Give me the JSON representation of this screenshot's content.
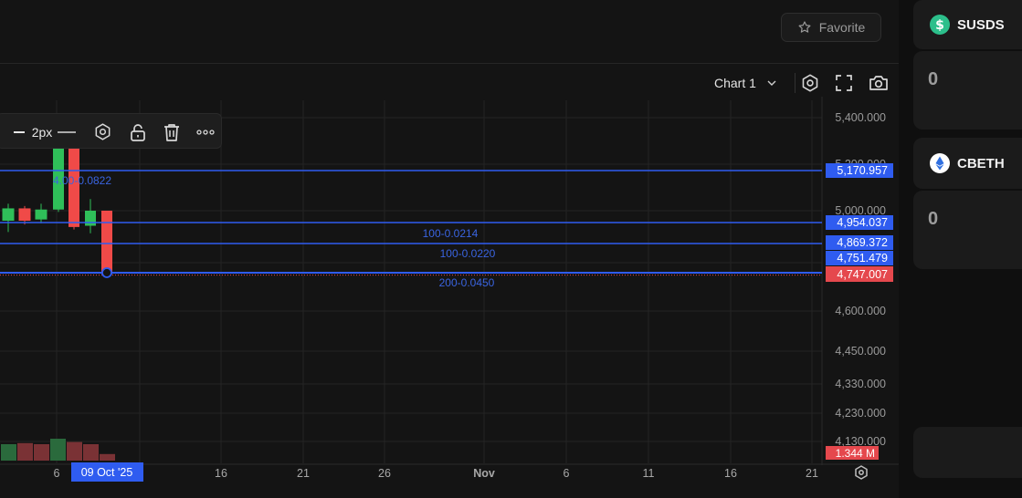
{
  "header": {
    "favorite_label": "Favorite"
  },
  "chart_toolbar": {
    "chart_select_label": "Chart 1",
    "icons": [
      "chevron-down-icon",
      "settings-hexagon-icon",
      "fullscreen-icon",
      "camera-icon"
    ]
  },
  "drawing_toolbar": {
    "line_width_label": "2px",
    "icons": [
      "line-width-icon",
      "line-style-icon",
      "settings-hexagon-icon",
      "unlock-icon",
      "trash-icon",
      "more-icon"
    ]
  },
  "chart_data": {
    "type": "candlestick",
    "price_axis_ticks": [
      "5,400.000",
      "5,200.000",
      "5,000.000",
      "4,600.000",
      "4,450.000",
      "4,330.000",
      "4,230.000",
      "4,130.000"
    ],
    "time_axis_ticks": [
      "6",
      "1",
      "16",
      "21",
      "26",
      "Nov",
      "6",
      "11",
      "16",
      "21"
    ],
    "crosshair_date": "09 Oct '25",
    "candles": [
      {
        "open": 4960,
        "close": 5010,
        "high": 5030,
        "low": 4915,
        "color": "green"
      },
      {
        "open": 5010,
        "close": 4960,
        "high": 5020,
        "low": 4945,
        "color": "red"
      },
      {
        "open": 4965,
        "close": 5005,
        "high": 5030,
        "low": 4950,
        "color": "green"
      },
      {
        "open": 5005,
        "close": 5275,
        "high": 5300,
        "low": 4995,
        "color": "green"
      },
      {
        "open": 5275,
        "close": 4935,
        "high": 5345,
        "low": 4925,
        "color": "red"
      },
      {
        "open": 4940,
        "close": 5000,
        "high": 5050,
        "low": 4910,
        "color": "green"
      },
      {
        "open": 5000,
        "close": 4747.007,
        "high": 5000,
        "low": 4747,
        "color": "red"
      }
    ],
    "horizontal_lines": [
      {
        "price_label": "5,170.957",
        "annotation": "4.00-0.0822",
        "color": "#2f5cf0"
      },
      {
        "price_label": "4,954.037",
        "annotation": "100-0.0214",
        "color": "#2f5cf0"
      },
      {
        "price_label": "4,869.372",
        "annotation": "100-0.0220",
        "color": "#2f5cf0"
      },
      {
        "price_label": "4,751.479",
        "annotation": "200-0.0450",
        "color": "#2f5cf0"
      }
    ],
    "current_price_label": "4,747.007",
    "volume_label": "1.344 M",
    "volume": [
      {
        "value": 0.75,
        "color": "green"
      },
      {
        "value": 0.8,
        "color": "red"
      },
      {
        "value": 0.75,
        "color": "red"
      },
      {
        "value": 1.0,
        "color": "green"
      },
      {
        "value": 0.85,
        "color": "red"
      },
      {
        "value": 0.75,
        "color": "red"
      },
      {
        "value": 0.3,
        "color": "red"
      }
    ],
    "colors": {
      "up": "#2fbf59",
      "down": "#f04a48",
      "drawing": "#2f5cf0",
      "current": "#e5484d"
    }
  },
  "sidebar": {
    "assets": [
      {
        "symbol": "SUSDS",
        "value": "0",
        "icon": "susds-coin-icon"
      },
      {
        "symbol": "CBETH",
        "value": "0",
        "icon": "cbeth-coin-icon"
      }
    ]
  }
}
